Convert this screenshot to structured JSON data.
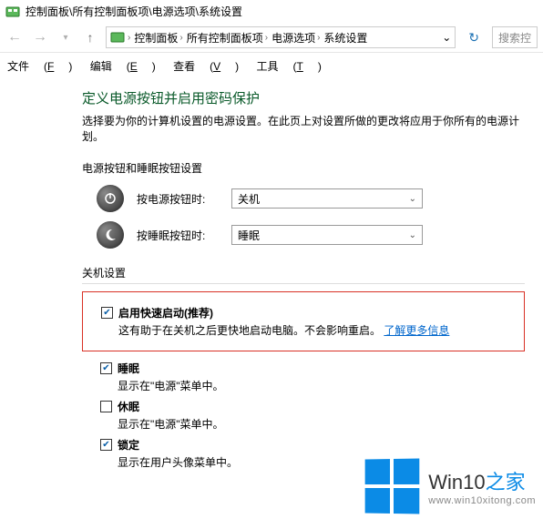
{
  "titlebar": {
    "path": "控制面板\\所有控制面板项\\电源选项\\系统设置"
  },
  "breadcrumb": {
    "items": [
      "控制面板",
      "所有控制面板项",
      "电源选项",
      "系统设置"
    ]
  },
  "search": {
    "placeholder": "搜索控"
  },
  "menu": {
    "file": "文件",
    "file_key": "F",
    "edit": "编辑",
    "edit_key": "E",
    "view": "查看",
    "view_key": "V",
    "tools": "工具",
    "tools_key": "T"
  },
  "page": {
    "heading": "定义电源按钮并启用密码保护",
    "desc": "选择要为你的计算机设置的电源设置。在此页上对设置所做的更改将应用于你所有的电源计划。",
    "button_sleep_section": "电源按钮和睡眠按钮设置",
    "power_button_label": "按电源按钮时:",
    "power_button_value": "关机",
    "sleep_button_label": "按睡眠按钮时:",
    "sleep_button_value": "睡眠",
    "shutdown_section": "关机设置",
    "fast_startup_label": "启用快速启动(推荐)",
    "fast_startup_desc": "这有助于在关机之后更快地启动电脑。不会影响重启。",
    "fast_startup_link": "了解更多信息",
    "sleep_label": "睡眠",
    "sleep_desc": "显示在\"电源\"菜单中。",
    "hibernate_label": "休眠",
    "hibernate_desc": "显示在\"电源\"菜单中。",
    "lock_label": "锁定",
    "lock_desc": "显示在用户头像菜单中。"
  },
  "watermark": {
    "line1a": "Win10",
    "line1b": "之家",
    "line2": "www.win10xitong.com"
  }
}
